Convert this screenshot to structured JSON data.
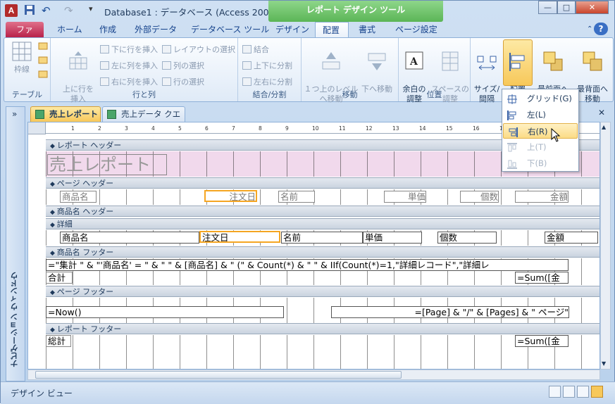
{
  "window": {
    "title": "Database1 : データベース (Access 200...",
    "context_title": "レポート デザイン ツール",
    "btn_minimize": "—",
    "btn_maximize": "□",
    "btn_close": "✕",
    "qat_undo": "↶",
    "qat_redo": "↷",
    "qat_more": "▾"
  },
  "tabs": [
    "ファイル",
    "ホーム",
    "作成",
    "外部データ",
    "データベース ツール",
    "デザイン",
    "配置",
    "書式",
    "ページ設定"
  ],
  "active_tab": "配置",
  "ribbon": {
    "table_group": {
      "label": "テーブル",
      "grid_btn": "枠線"
    },
    "rows_cols": {
      "label": "行と列",
      "insert_above": "上に行を\n挿入",
      "insert_below": "下に行を挿入",
      "insert_left": "左に列を挿入",
      "insert_right": "右に列を挿入",
      "select_layout": "レイアウトの選択",
      "select_col": "列の選択",
      "select_row": "行の選択"
    },
    "merge_split": {
      "label": "結合/分割",
      "merge": "結合",
      "split_v": "上下に分割",
      "split_h": "左右に分割"
    },
    "move": {
      "label": "移動",
      "up": "１つ上のレベル\nへ移動",
      "down": "下へ移動"
    },
    "position": {
      "label": "位置",
      "margins": "余白の\n調整",
      "padding": "スペースの\n調整"
    },
    "sizing": {
      "label": "",
      "size": "サイズ/\n間隔",
      "align": "配置",
      "front": "最前面へ\n移動",
      "back": "最背面へ\n移動"
    }
  },
  "dropdown": {
    "items": [
      {
        "label": "グリッド(G)",
        "enabled": true
      },
      {
        "label": "左(L)",
        "enabled": true
      },
      {
        "label": "右(R)",
        "enabled": true
      },
      {
        "label": "上(T)",
        "enabled": false
      },
      {
        "label": "下(B)",
        "enabled": false
      }
    ]
  },
  "nav_pane": {
    "toggle": "»",
    "title": "ナビゲーション ウィンドウ"
  },
  "doc_tabs": [
    {
      "label": "売上レポート",
      "active": true
    },
    {
      "label": "売上データ クエリ",
      "active": false
    }
  ],
  "doc_close": "✕",
  "ruler_numbers": [
    "1",
    "2",
    "3",
    "4",
    "5",
    "6",
    "7",
    "8",
    "9",
    "10",
    "11",
    "12",
    "13",
    "14",
    "15",
    "16",
    "17"
  ],
  "sections": {
    "report_header": "レポート ヘッダー",
    "page_header": "ページ ヘッダー",
    "group_header": "商品名 ヘッダー",
    "detail": "詳細",
    "group_footer": "商品名 フッター",
    "page_footer": "ページ フッター",
    "report_footer": "レポート フッター"
  },
  "controls": {
    "report_title": "売上レポート",
    "ph_product": "商品名",
    "ph_orderdate": "注文日",
    "ph_name": "名前",
    "ph_price": "単価",
    "ph_qty": "個数",
    "ph_amount": "金額",
    "d_product": "商品名",
    "d_orderdate": "注文日",
    "d_name": "名前",
    "d_price": "単価",
    "d_qty": "個数",
    "d_amount": "金額",
    "gf_expr": "=\"集計 \" & \"'商品名' = \" & \" \" & [商品名] & \" (\" & Count(*) & \" \" & IIf(Count(*)=1,\"詳細レコード\",\"詳細レ",
    "gf_total_label": "合計",
    "gf_sum": "=Sum([金",
    "pf_now": "=Now()",
    "pf_page": "=[Page] & \"/\" & [Pages] & \" ページ\"",
    "rf_total_label": "総計",
    "rf_sum": "=Sum([金"
  },
  "status": {
    "text": "デザイン ビュー"
  }
}
